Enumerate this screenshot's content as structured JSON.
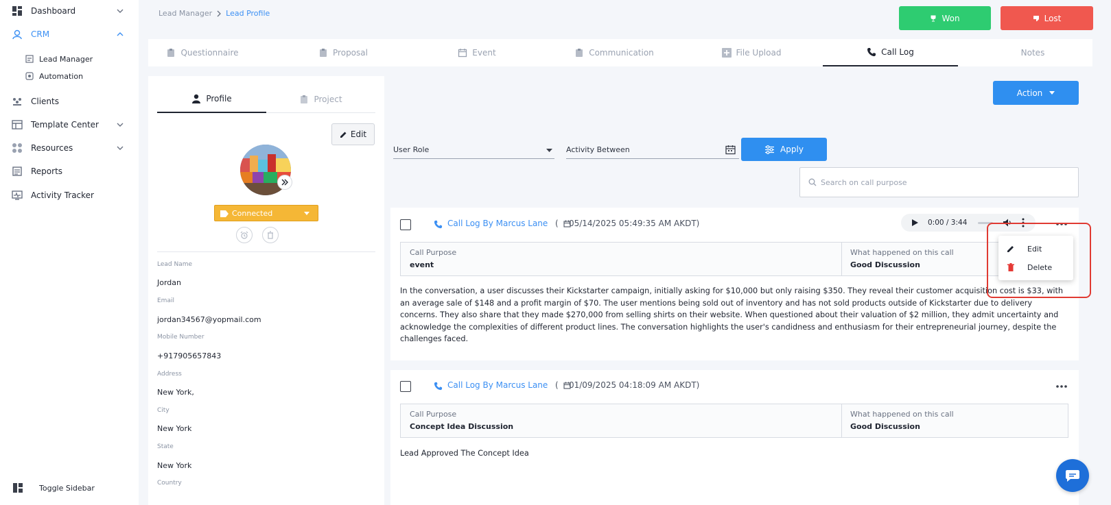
{
  "sidebar": {
    "items": [
      {
        "label": "Dashboard",
        "icon": "dashboard-icon"
      },
      {
        "label": "CRM",
        "icon": "crm-icon"
      },
      {
        "label": "Clients",
        "icon": "clients-icon"
      },
      {
        "label": "Template Center",
        "icon": "template-icon"
      },
      {
        "label": "Resources",
        "icon": "resources-icon"
      },
      {
        "label": "Reports",
        "icon": "reports-icon"
      },
      {
        "label": "Activity Tracker",
        "icon": "activity-icon"
      }
    ],
    "crm_sub": [
      {
        "label": "Lead Manager",
        "icon": "lead-manager-icon"
      },
      {
        "label": "Automation",
        "icon": "automation-icon"
      }
    ],
    "toggle_label": "Toggle Sidebar"
  },
  "breadcrumb": {
    "parent": "Lead Manager",
    "current": "Lead Profile"
  },
  "header": {
    "won_label": "Won",
    "lost_label": "Lost"
  },
  "tabs": [
    {
      "label": "Questionnaire"
    },
    {
      "label": "Proposal"
    },
    {
      "label": "Event"
    },
    {
      "label": "Communication"
    },
    {
      "label": "File Upload"
    },
    {
      "label": "Call Log",
      "active": true
    },
    {
      "label": "Notes"
    }
  ],
  "profile": {
    "tabs": {
      "profile": "Profile",
      "project": "Project"
    },
    "edit_label": "Edit",
    "status": "Connected",
    "fields": [
      {
        "label": "Lead Name",
        "value": "Jordan"
      },
      {
        "label": "Email",
        "value": "jordan34567@yopmail.com"
      },
      {
        "label": "Mobile Number",
        "value": "+917905657843"
      },
      {
        "label": "Address",
        "value": "New York,"
      },
      {
        "label": "City",
        "value": "New York"
      },
      {
        "label": "State",
        "value": "New York"
      },
      {
        "label": "Country",
        "value": ""
      }
    ]
  },
  "call_log": {
    "action_label": "Action",
    "filters": {
      "user_role": "User Role",
      "activity_between": "Activity Between",
      "apply": "Apply"
    },
    "search_placeholder": "Search on call purpose",
    "audio": {
      "time": "0:00 / 3:44"
    },
    "menu": {
      "edit": "Edit",
      "delete": "Delete"
    },
    "entries": [
      {
        "by": "Call Log By Marcus Lane",
        "date": "(    05/14/2025 05:49:35 AM AKDT)",
        "purpose_label": "Call Purpose",
        "purpose": "event",
        "happened_label": "What happened on this call",
        "happened": "Good Discussion",
        "body": "In the conversation, a user discusses their Kickstarter campaign, initially asking for $10,000 but only raising $350. They reveal their customer acquisition cost is $33, with an average sale of $148 and a profit margin of $70. The user mentions being sold out of inventory and has not sold products outside of Kickstarter due to delivery concerns. They also share that they made $270,000 from selling shirts on their website. When questioned about their valuation of $2 million, they admit uncertainty and acknowledge the complexities of different product lines. The conversation highlights the user's candidness and enthusiasm for their entrepreneurial journey, despite the challenges faced."
      },
      {
        "by": "Call Log By Marcus Lane",
        "date": "(    01/09/2025 04:18:09 AM AKDT)",
        "purpose_label": "Call Purpose",
        "purpose": "Concept Idea Discussion",
        "happened_label": "What happened on this call",
        "happened": "Good Discussion",
        "body": "Lead Approved The Concept Idea"
      }
    ]
  },
  "colors": {
    "accent": "#2f8ff0",
    "won": "#2ecc71",
    "lost": "#f0584f",
    "status": "#f5b736",
    "highlight": "#e03a32"
  }
}
